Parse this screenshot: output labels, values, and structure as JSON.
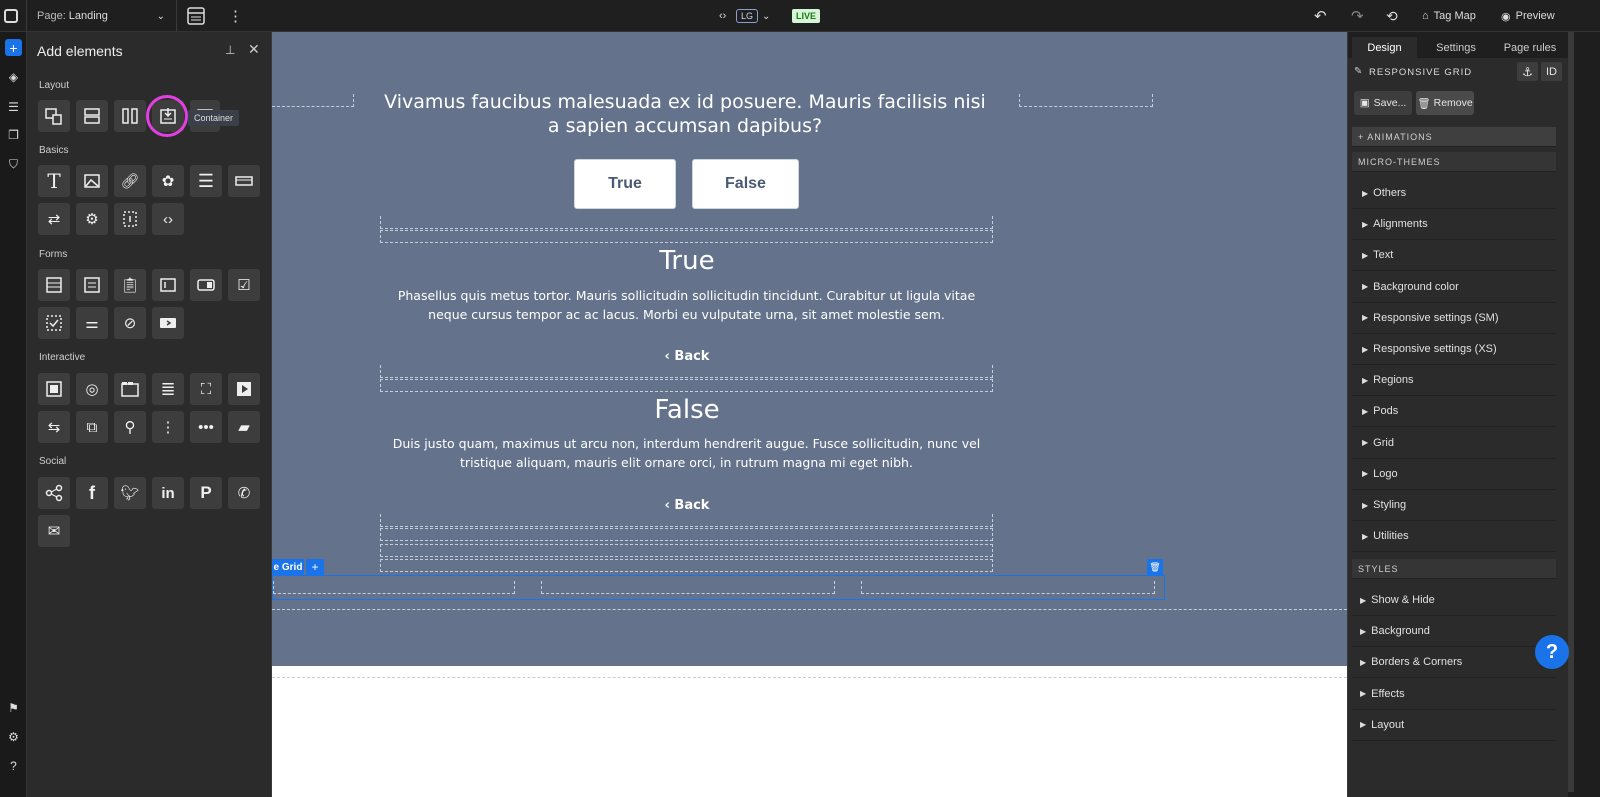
{
  "topbar": {
    "page_label": "Page:",
    "page_name": "Landing",
    "breakpoint": "LG",
    "live": "LIVE",
    "tag_map": "Tag Map",
    "preview": "Preview"
  },
  "panel": {
    "title": "Add elements",
    "sections": [
      "Layout",
      "Basics",
      "Forms",
      "Interactive",
      "Social"
    ],
    "tooltip": "Container"
  },
  "canvas": {
    "question": "Vivamus faucibus malesuada ex id posuere. Mauris facilisis nisi a sapien accumsan dapibus?",
    "btn_true": "True",
    "btn_false": "False",
    "true_heading": "True",
    "true_text": "Phasellus quis metus tortor. Mauris sollicitudin sollicitudin tincidunt. Curabitur ut ligula vitae neque cursus tempor ac ac lacus. Morbi eu vulputate urna, sit amet molestie sem.",
    "back1": "Back",
    "false_heading": "False",
    "false_text": "Duis justo quam, maximus ut arcu non, interdum hendrerit augue. Fusce sollicitudin, nunc vel tristique aliquam, mauris elit ornare orci, in rutrum magna mi eget nibh.",
    "back2": "Back",
    "grid_label": "e Grid",
    "grid_plus": "+"
  },
  "rpanel": {
    "tabs": [
      "Design",
      "Settings",
      "Page rules"
    ],
    "element_name": "RESPONSIVE GRID",
    "id_label": "ID",
    "save": "Save...",
    "remove": "Remove",
    "animations": "+ ANIMATIONS",
    "micro_themes": "MICRO-THEMES",
    "micro_items": [
      "Others",
      "Alignments",
      "Text",
      "Background color",
      "Responsive settings (SM)",
      "Responsive settings (XS)",
      "Regions",
      "Pods",
      "Grid",
      "Logo",
      "Styling",
      "Utilities"
    ],
    "styles": "STYLES",
    "style_items": [
      "Show & Hide",
      "Background",
      "Borders & Corners",
      "Effects",
      "Layout"
    ]
  },
  "help": "?",
  "colors": {
    "accent": "#1a73e8",
    "highlight": "#e040e0",
    "stage": "#64738b"
  }
}
